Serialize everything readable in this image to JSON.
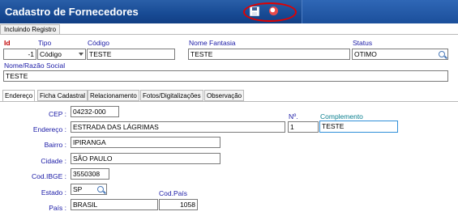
{
  "window": {
    "title": "Cadastro de Fornecedores"
  },
  "status": {
    "label": "Incluindo Registro"
  },
  "header": {
    "id": {
      "label": "Id",
      "value": "-1"
    },
    "tipo": {
      "label": "Tipo",
      "value": "Código"
    },
    "codigo": {
      "label": "Código",
      "value": "TESTE"
    },
    "nome_fantasia": {
      "label": "Nome Fantasia",
      "value": "TESTE"
    },
    "status": {
      "label": "Status",
      "value": "OTIMO"
    },
    "razao_social": {
      "label": "Nome/Razão Social",
      "value": "TESTE"
    }
  },
  "tabs": [
    {
      "label": "Endereço",
      "active": true
    },
    {
      "label": "Ficha Cadastral",
      "active": false
    },
    {
      "label": "Relacionamento",
      "active": false
    },
    {
      "label": "Fotos/Digitalizações",
      "active": false
    },
    {
      "label": "Observação",
      "active": false
    }
  ],
  "address": {
    "cep": {
      "label": "CEP :",
      "value": "04232-000"
    },
    "endereco": {
      "label": "Endereço :",
      "value": "ESTRADA DAS LÁGRIMAS"
    },
    "numero": {
      "label": "Nº.",
      "value": "1"
    },
    "complemento": {
      "label": "Complemento",
      "value": "TESTE"
    },
    "bairro": {
      "label": "Bairro :",
      "value": "IPIRANGA"
    },
    "cidade": {
      "label": "Cidade :",
      "value": "SÃO PAULO"
    },
    "cod_ibge": {
      "label": "Cod.IBGE :",
      "value": "3550308"
    },
    "estado": {
      "label": "Estado :",
      "value": "SP"
    },
    "pais": {
      "label": "País :",
      "value": "BRASIL"
    },
    "cod_pais": {
      "label": "Cod.País",
      "value": "1058"
    }
  },
  "icons": {
    "save": "save-icon",
    "other": "circle-icon",
    "lookup": "magnifier-icon"
  },
  "colors": {
    "titlebar": "#174a94",
    "label": "#1a1aa6",
    "required": "#c00000",
    "highlight": "#e10000"
  }
}
